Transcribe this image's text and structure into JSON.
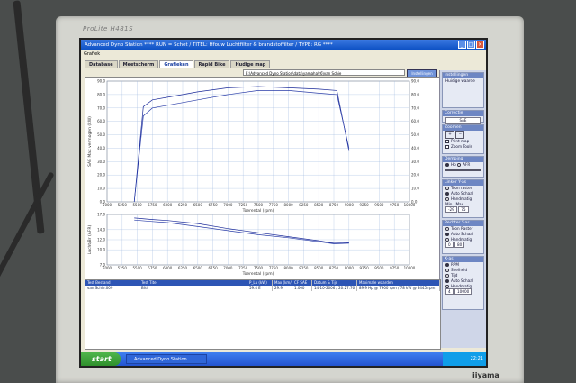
{
  "monitor": {
    "brand": "ProLite H481S",
    "logo": "iiyama"
  },
  "window": {
    "title": "Advanced Dyno Station   ****  RUN = Schet  /  TITEL: Hfouw Luchtfilter & brandstoffilter  /  TYPE: RG ****",
    "menu": "Grafiek",
    "tabs": [
      "Database",
      "Meetscherm",
      "Grafieken",
      "Rapid Bike",
      "Hudige map"
    ],
    "active_tab": "Grafieken",
    "path": "E:\\Advanced Dyno Station\\data\\yamaha\\r6\\van Schie",
    "instellingen": "Instellingen"
  },
  "chart_data": [
    {
      "type": "line",
      "xlabel": "Toerental (rpm)",
      "ylabel": "SAE Max vermogen (kW)",
      "y2label": "",
      "xlim": [
        5000,
        10000
      ],
      "ylim": [
        0,
        90
      ],
      "y2lim": [
        0,
        90
      ],
      "x_ticks": [
        "5000",
        "5250",
        "5500",
        "5750",
        "6000",
        "6250",
        "6500",
        "6750",
        "7000",
        "7250",
        "7500",
        "7750",
        "8000",
        "8250",
        "8500",
        "8750",
        "9000",
        "9250",
        "9500",
        "9750",
        "10000"
      ],
      "y_ticks": [
        "0.0",
        "10.0",
        "20.0",
        "30.0",
        "40.0",
        "50.0",
        "60.0",
        "70.0",
        "80.0",
        "90.0"
      ],
      "y2_ticks": [
        "0.0",
        "10.0",
        "20.0",
        "30.0",
        "40.0",
        "50.0",
        "60.0",
        "70.0",
        "80.0",
        "90.0"
      ],
      "series": [
        {
          "x": [
            5450,
            5600,
            5750,
            6000,
            6500,
            7000,
            7500,
            8000,
            8500,
            8800,
            9000
          ],
          "y": [
            0,
            71,
            76,
            78,
            82,
            85,
            86,
            85,
            84,
            83,
            38
          ]
        },
        {
          "x": [
            5450,
            5600,
            5750,
            6000,
            6500,
            7000,
            7500,
            8000,
            8500,
            8800,
            9000
          ],
          "y": [
            0,
            64,
            70,
            72,
            76,
            80,
            83,
            83,
            81,
            80,
            40
          ]
        }
      ]
    },
    {
      "type": "line",
      "xlabel": "Toerental (rpm)",
      "ylabel": "Lucht/Br (AFR)",
      "xlim": [
        5000,
        10000
      ],
      "ylim": [
        7.0,
        17.0
      ],
      "x_ticks": [
        "5000",
        "5250",
        "5500",
        "5750",
        "6000",
        "6250",
        "6500",
        "6750",
        "7000",
        "7250",
        "7500",
        "7750",
        "8000",
        "8250",
        "8500",
        "8750",
        "9000",
        "9250",
        "9500",
        "9750",
        "10000"
      ],
      "y_ticks": [
        "7.0",
        "10.0",
        "12.0",
        "14.0",
        "17.0"
      ],
      "series": [
        {
          "x": [
            5450,
            5750,
            6000,
            6500,
            7000,
            7500,
            8000,
            8500,
            8750,
            9000
          ],
          "y": [
            16.3,
            16.0,
            15.8,
            15.2,
            14.2,
            13.4,
            12.6,
            11.8,
            11.3,
            11.4
          ]
        },
        {
          "x": [
            5450,
            5750,
            6000,
            6500,
            7000,
            7500,
            8000,
            8500,
            8750,
            9000
          ],
          "y": [
            15.9,
            15.6,
            15.4,
            14.6,
            13.8,
            13.0,
            12.4,
            11.6,
            11.2,
            11.3
          ]
        }
      ]
    }
  ],
  "right_panel": {
    "instellingen_title": "Instellingen",
    "huidige": "Huidige waarde",
    "correctie_title": "Correctie",
    "correctie_value": "SAE",
    "zoomen_title": "Zoomen",
    "print_map": "Print map",
    "zoom_tools": "Zoom Tools",
    "dempen_title": "Demping",
    "dempen_opts": [
      "Hp",
      "AFR"
    ],
    "linker_title": "Linker Y-as",
    "linker_opts": [
      "Toon raster",
      "Auto Schaal",
      "Handmatig"
    ],
    "linker_min": "Min",
    "linker_max": "Max",
    "linker_vals": [
      "-29",
      "75"
    ],
    "rechter_title": "Rechter Y-as",
    "rechter_opts": [
      "Toon Raster",
      "Auto Schaal",
      "Handmatig"
    ],
    "rechter_vals": [
      "0",
      "80"
    ],
    "xas_title": "X-as",
    "xas_opts": [
      "RPM",
      "Snelheid",
      "Tijd"
    ],
    "xas_opts2": [
      "Auto Schaal",
      "Handmatig"
    ],
    "xas_vals": [
      "4",
      "10000"
    ]
  },
  "table": {
    "headers": [
      "Test Bestand",
      "Test Titel",
      "P_Lu (kW)",
      "Max (km/h)",
      "CF SAE",
      "Datum & Tijd",
      "Maximale waarden"
    ],
    "row": [
      "van Schie.009",
      "Bfd",
      "59.4 E",
      "29.9",
      "1.000",
      "14-10-2006 / 20:27:76",
      "89.9 Hp @ 7900 rpm  / 78 kW @ 8445 rpm"
    ]
  },
  "taskbar": {
    "start": "start",
    "task": "Advanced Dyno Station",
    "clock": "22:21"
  }
}
